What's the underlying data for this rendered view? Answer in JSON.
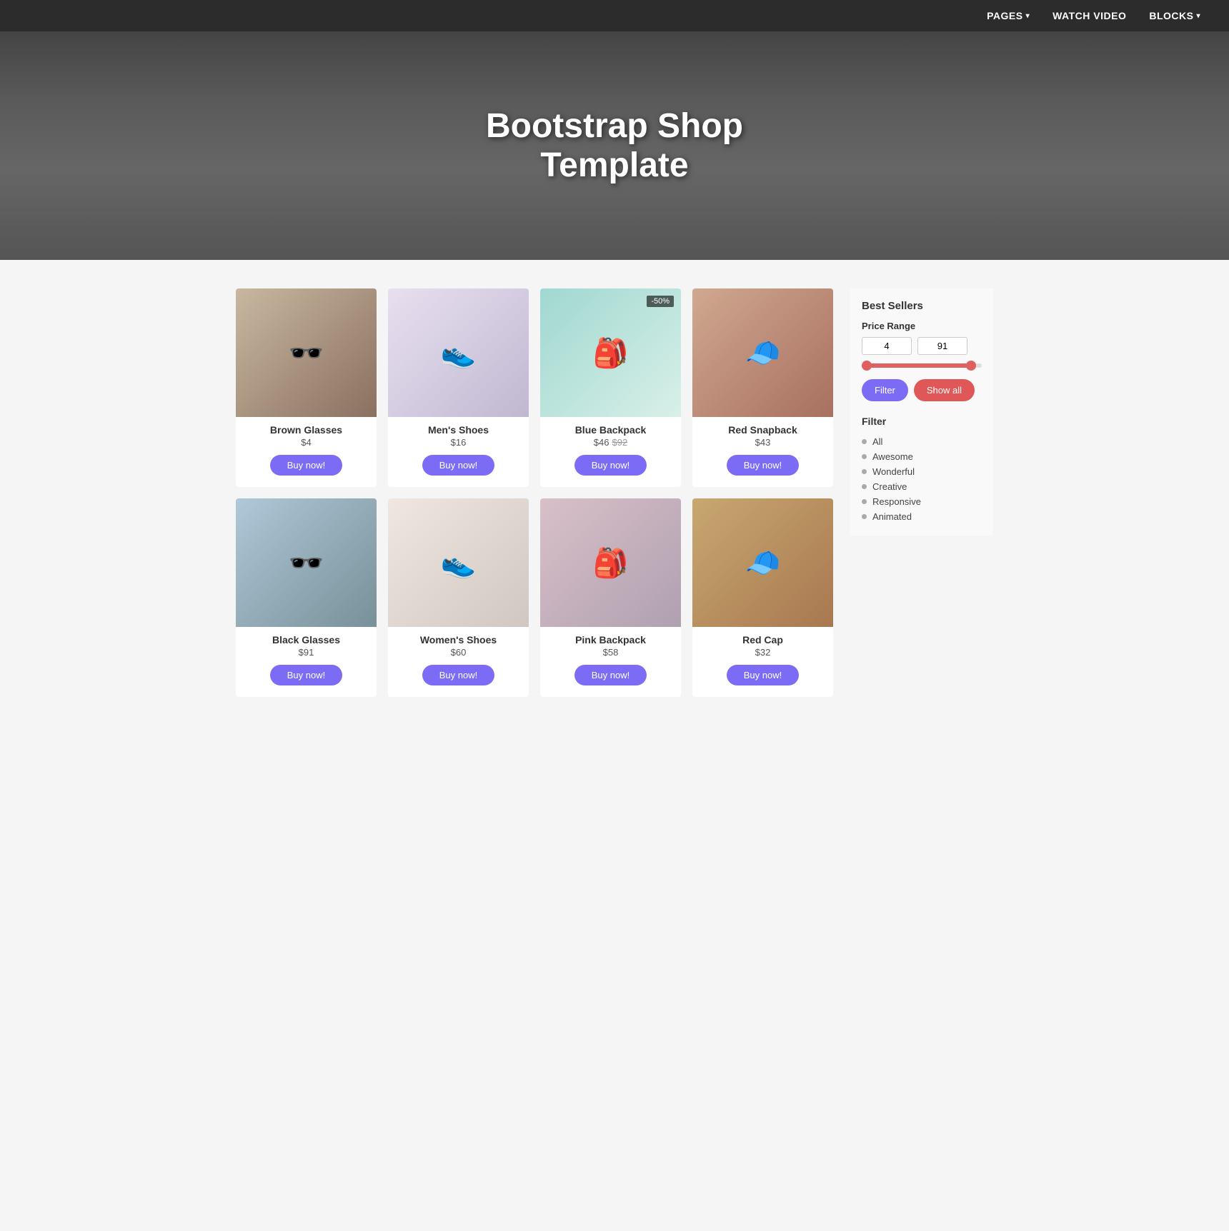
{
  "nav": {
    "items": [
      {
        "label": "PAGES",
        "hasArrow": true
      },
      {
        "label": "WATCH VIDEO",
        "hasArrow": false
      },
      {
        "label": "BLOCKS",
        "hasArrow": true
      }
    ]
  },
  "hero": {
    "title_line1": "Bootstrap Shop",
    "title_line2": "Template"
  },
  "products": [
    {
      "name": "Brown Glasses",
      "price": "$4",
      "originalPrice": null,
      "discount": null,
      "imgClass": "img-brown-glasses",
      "emoji": "🕶️"
    },
    {
      "name": "Men's Shoes",
      "price": "$16",
      "originalPrice": null,
      "discount": null,
      "imgClass": "img-mens-shoes",
      "emoji": "👟"
    },
    {
      "name": "Blue Backpack",
      "price": "$46",
      "originalPrice": "$92",
      "discount": "-50%",
      "imgClass": "img-blue-backpack",
      "emoji": "🎒"
    },
    {
      "name": "Red Snapback",
      "price": "$43",
      "originalPrice": null,
      "discount": null,
      "imgClass": "img-red-snapback",
      "emoji": "🧢"
    },
    {
      "name": "Black Glasses",
      "price": "$91",
      "originalPrice": null,
      "discount": null,
      "imgClass": "img-black-glasses",
      "emoji": "🕶️"
    },
    {
      "name": "Women's Shoes",
      "price": "$60",
      "originalPrice": null,
      "discount": null,
      "imgClass": "img-womens-shoes",
      "emoji": "👟"
    },
    {
      "name": "Pink Backpack",
      "price": "$58",
      "originalPrice": null,
      "discount": null,
      "imgClass": "img-pink-backpack",
      "emoji": "🎒"
    },
    {
      "name": "Red Cap",
      "price": "$32",
      "originalPrice": null,
      "discount": null,
      "imgClass": "img-red-cap",
      "emoji": "🧢"
    }
  ],
  "sidebar": {
    "best_sellers_label": "Best Sellers",
    "price_range_label": "Price Range",
    "price_min": "4",
    "price_max": "91",
    "filter_btn_label": "Filter",
    "show_all_btn_label": "Show all",
    "filter_section_label": "Filter",
    "filter_items": [
      {
        "label": "All"
      },
      {
        "label": "Awesome"
      },
      {
        "label": "Wonderful"
      },
      {
        "label": "Creative"
      },
      {
        "label": "Responsive"
      },
      {
        "label": "Animated"
      }
    ]
  },
  "buy_now_label": "Buy now!"
}
